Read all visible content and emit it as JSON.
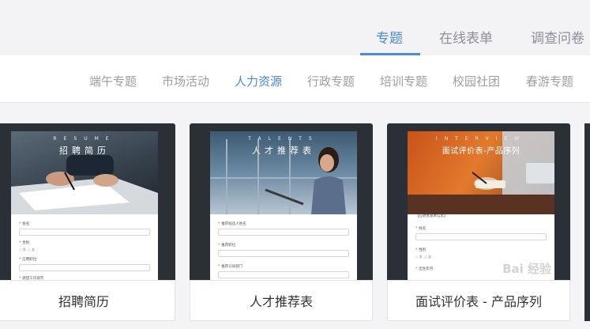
{
  "top_tabs": [
    {
      "label": "专题",
      "active": true
    },
    {
      "label": "在线表单",
      "active": false
    },
    {
      "label": "调查问卷",
      "active": false
    }
  ],
  "categories": [
    {
      "label": "端午专题",
      "active": false
    },
    {
      "label": "市场活动",
      "active": false
    },
    {
      "label": "人力资源",
      "active": true
    },
    {
      "label": "行政专题",
      "active": false
    },
    {
      "label": "培训专题",
      "active": false
    },
    {
      "label": "校园社团",
      "active": false
    },
    {
      "label": "春游专题",
      "active": false
    }
  ],
  "cards": [
    {
      "title": "招聘简历",
      "banner_sub": "RESUME",
      "banner_title": "招聘简历",
      "fields": [
        {
          "label": "姓名",
          "type": "input"
        },
        {
          "label": "性别",
          "type": "radio",
          "options": [
            "男",
            "女"
          ]
        },
        {
          "label": "应聘职位",
          "type": "input"
        },
        {
          "label": "期望工作城市",
          "type": "input"
        }
      ]
    },
    {
      "title": "人才推荐表",
      "banner_sub": "TALENTS",
      "banner_title": "人才推荐表",
      "fields": [
        {
          "label": "推荐候选人姓名",
          "type": "input"
        },
        {
          "label": "推荐职位",
          "type": "input"
        },
        {
          "label": "推荐认知部门",
          "type": "input"
        }
      ]
    },
    {
      "title": "面试评价表 - 产品序列",
      "banner_sub": "INTERVIEW",
      "banner_title": "面试评价表-产品序列",
      "section": "【应聘者基本信息】",
      "fields": [
        {
          "label": "姓名",
          "type": "input"
        },
        {
          "label": "性别",
          "type": "radio",
          "options": [
            "男",
            "女"
          ]
        },
        {
          "label": "出生年月",
          "type": "input"
        }
      ]
    }
  ],
  "watermark": "Bai 经验",
  "colors": {
    "accent": "#4a8ad6",
    "card_bg": "#2b2f36"
  }
}
